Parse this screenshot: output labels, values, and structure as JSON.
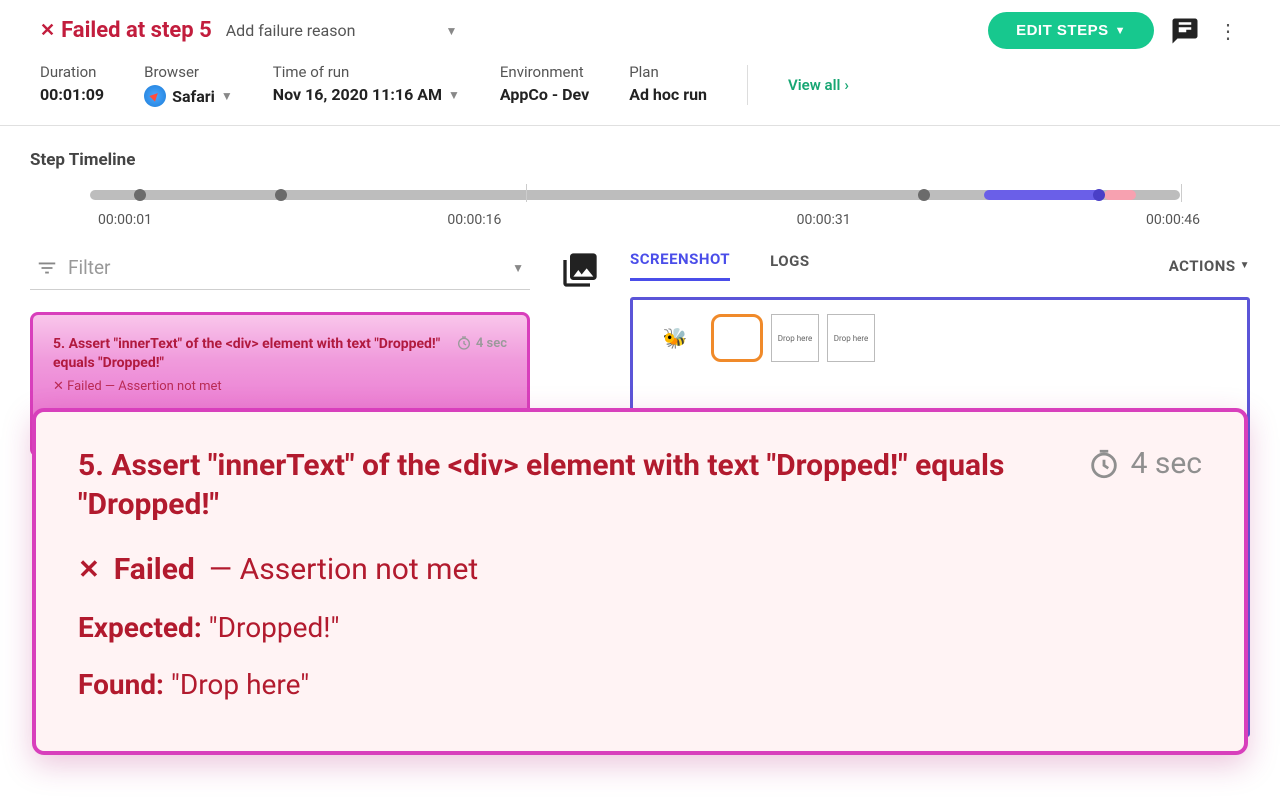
{
  "header": {
    "status_text": "Failed at step 5",
    "failure_reason_placeholder": "Add failure reason",
    "edit_steps_label": "EDIT STEPS"
  },
  "meta": {
    "duration_label": "Duration",
    "duration_value": "00:01:09",
    "browser_label": "Browser",
    "browser_value": "Safari",
    "time_label": "Time of run",
    "time_value": "Nov 16, 2020 11:16 AM",
    "env_label": "Environment",
    "env_value": "AppCo - Dev",
    "plan_label": "Plan",
    "plan_value": "Ad hoc run",
    "view_all": "View all"
  },
  "timeline": {
    "title": "Step Timeline",
    "ticks": [
      "00:00:01",
      "00:00:16",
      "00:00:31",
      "00:00:46"
    ]
  },
  "filter": {
    "placeholder": "Filter"
  },
  "tabs": {
    "screenshot": "SCREENSHOT",
    "logs": "LOGS",
    "actions": "ACTIONS"
  },
  "screenshot_boxes": {
    "b2": "",
    "b3": "Drop here",
    "b4": "Drop here"
  },
  "step": {
    "title": "5. Assert \"innerText\" of the <div> element with text \"Dropped!\" equals \"Dropped!\"",
    "time": "4 sec",
    "sub": "✕ Failed — Assertion not met"
  },
  "detail": {
    "title": "5. Assert \"innerText\" of the <div> element with text \"Dropped!\" equals \"Dropped!\"",
    "time": "4 sec",
    "status1": "Failed",
    "status2": "— Assertion not met",
    "expected_label": "Expected:",
    "expected_value": "\"Dropped!\"",
    "found_label": "Found:",
    "found_value": "\"Drop here\""
  }
}
